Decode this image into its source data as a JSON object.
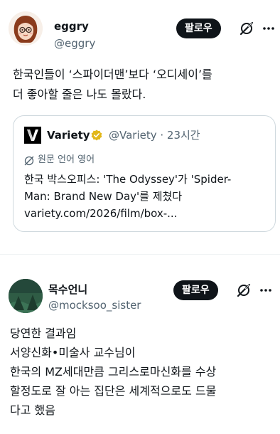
{
  "posts": [
    {
      "author": {
        "name": "eggry",
        "handle": "@eggry"
      },
      "follow_label": "팔로우",
      "text_lines": [
        "한국인들이 ‘스파이더맨’보다 ‘오디세이’를",
        "더 좋아할 줄은 나도 몰랐다."
      ],
      "quote": {
        "name": "Variety",
        "handle_time": "@Variety · 23시간",
        "translate_label": "원문 언어 영어",
        "text_lines": [
          "한국 박스오피스: 'The Odyssey'가 'Spider-",
          "Man: Brand New Day'를 제쳤다"
        ],
        "link": "variety.com/2026/film/box-..."
      }
    },
    {
      "author": {
        "name": "목수언니",
        "handle": "@mocksoo_sister"
      },
      "follow_label": "팔로우",
      "text_lines": [
        "당연한 결과임",
        "서양신화•미술사 교수님이",
        "한국의 MZ세대만큼 그리스로마신화를 수상",
        "할정도로 잘 아는 집단은 세계적으로도 드물",
        "다고 했음"
      ]
    }
  ],
  "colors": {
    "text": "#0f1419",
    "secondary": "#536471",
    "follow_bg": "#0f1419",
    "border": "#cfd9de",
    "verified": "#e2b719"
  },
  "icons": {
    "grok": "grok-icon",
    "more": "more-icon",
    "verified": "verified-badge-icon",
    "translate": "translate-icon"
  }
}
